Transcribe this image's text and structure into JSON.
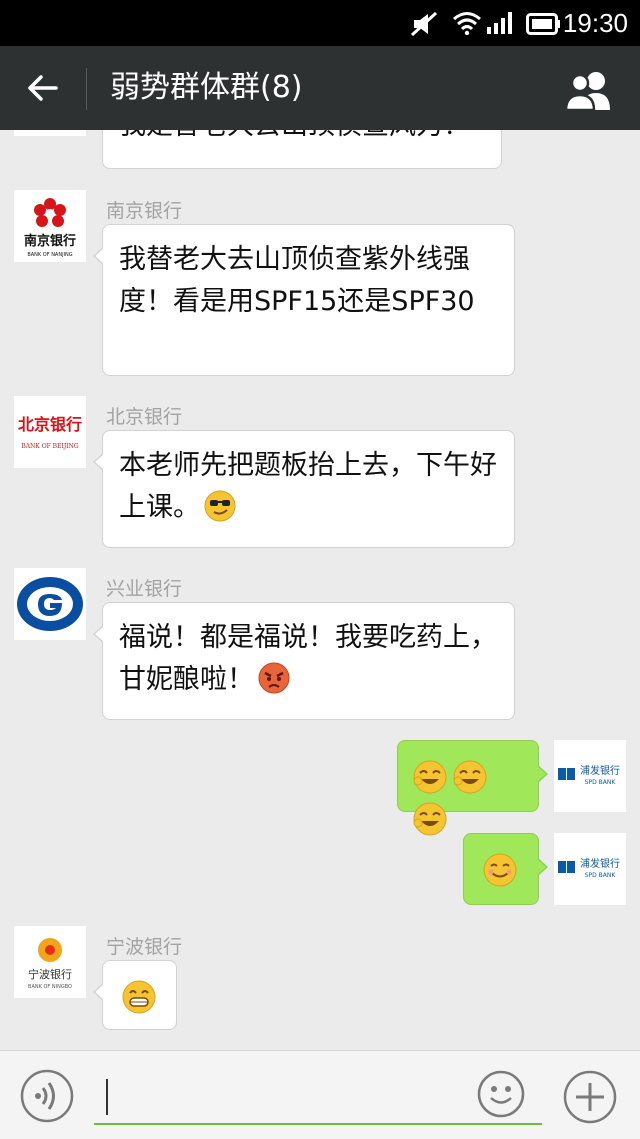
{
  "status_bar": {
    "time": "19:30"
  },
  "header": {
    "title": "弱势群体群(8)"
  },
  "messages": [
    {
      "text_partial": "我是替老大去山顶侦查风力！"
    },
    {
      "sender": "南京银行",
      "avatar_text": "南京银行",
      "avatar_sub": "BANK OF NANJING",
      "text": "我替老大去山顶侦查紫外线强度！看是用SPF15还是SPF30"
    },
    {
      "sender": "北京银行",
      "avatar_text": "北京银行",
      "avatar_sub": "BANK OF BEIJING",
      "text": "本老师先把题板抬上去，下午好上课。",
      "emoji": "sunglasses-emoji"
    },
    {
      "sender": "兴业银行",
      "text": "福说！都是福说！我要吃药上，甘妮酿啦！",
      "emoji": "angry-emoji"
    },
    {
      "sender_self": true,
      "avatar_text": "浦发银行",
      "avatar_sub": "SPD BANK",
      "emojis": [
        "laugh-emoji",
        "laugh-emoji",
        "laugh-emoji"
      ]
    },
    {
      "sender_self": true,
      "avatar_text": "浦发银行",
      "avatar_sub": "SPD BANK",
      "emojis": [
        "smile-emoji"
      ]
    },
    {
      "sender": "宁波银行",
      "avatar_text": "宁波银行",
      "avatar_sub": "BANK OF NINGBO",
      "emojis": [
        "grin-emoji"
      ]
    }
  ],
  "colors": {
    "title_bar": "#2e3132",
    "self_bubble": "#a0e759",
    "chat_bg": "#ebebeb",
    "input_underline": "#6bbf3c"
  }
}
